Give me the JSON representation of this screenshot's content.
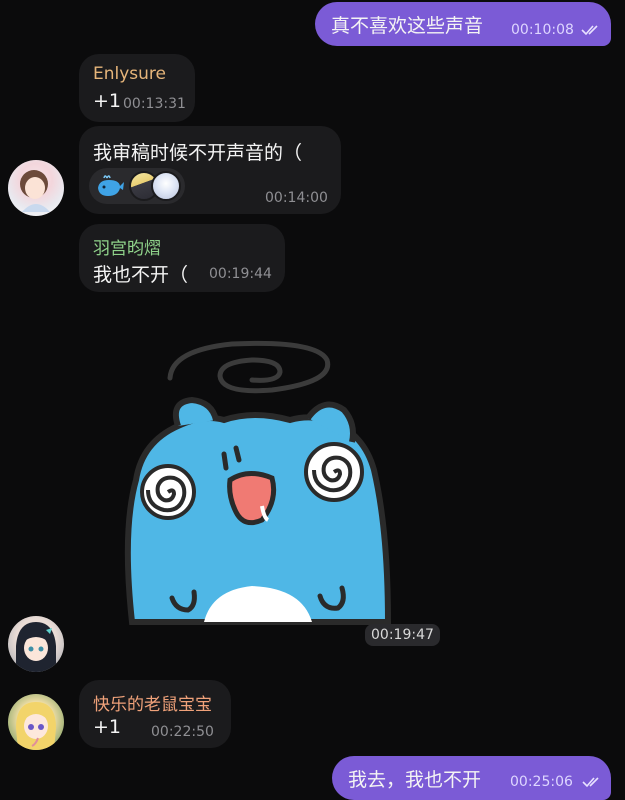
{
  "colors": {
    "background": "#0b0b0c",
    "outgoing_bubble": "#7b5bd6",
    "incoming_bubble": "#1b1b1d",
    "enlysure_name": "#e6b57a",
    "yugong_name": "#8fd28a",
    "kuaile_name": "#f0a27a",
    "sticker_cat": "#4fb7e6"
  },
  "messages": [
    {
      "id": "m1",
      "direction": "out",
      "text": "真不喜欢这些声音",
      "time": "00:10:08",
      "read": true
    },
    {
      "id": "m2",
      "direction": "in",
      "sender": "Enlysure",
      "text": "+1",
      "time": "00:13:31"
    },
    {
      "id": "m3",
      "direction": "in",
      "text": "我审稿时候不开声音的（",
      "time": "00:14:00",
      "reactions": [
        "whale-emoji",
        "reactor-avatar-1",
        "reactor-avatar-2"
      ]
    },
    {
      "id": "m4",
      "direction": "in",
      "sender": "羽宫昀熠",
      "text": "我也不开（",
      "time": "00:19:44"
    },
    {
      "id": "m5",
      "direction": "in",
      "type": "sticker",
      "sticker": "dizzy-blue-cat-sticker",
      "time": "00:19:47"
    },
    {
      "id": "m6",
      "direction": "in",
      "sender": "快乐的老鼠宝宝",
      "text": "+1",
      "time": "00:22:50"
    },
    {
      "id": "m7",
      "direction": "out",
      "text": "我去，我也不开",
      "time": "00:25:06",
      "read": true
    }
  ]
}
